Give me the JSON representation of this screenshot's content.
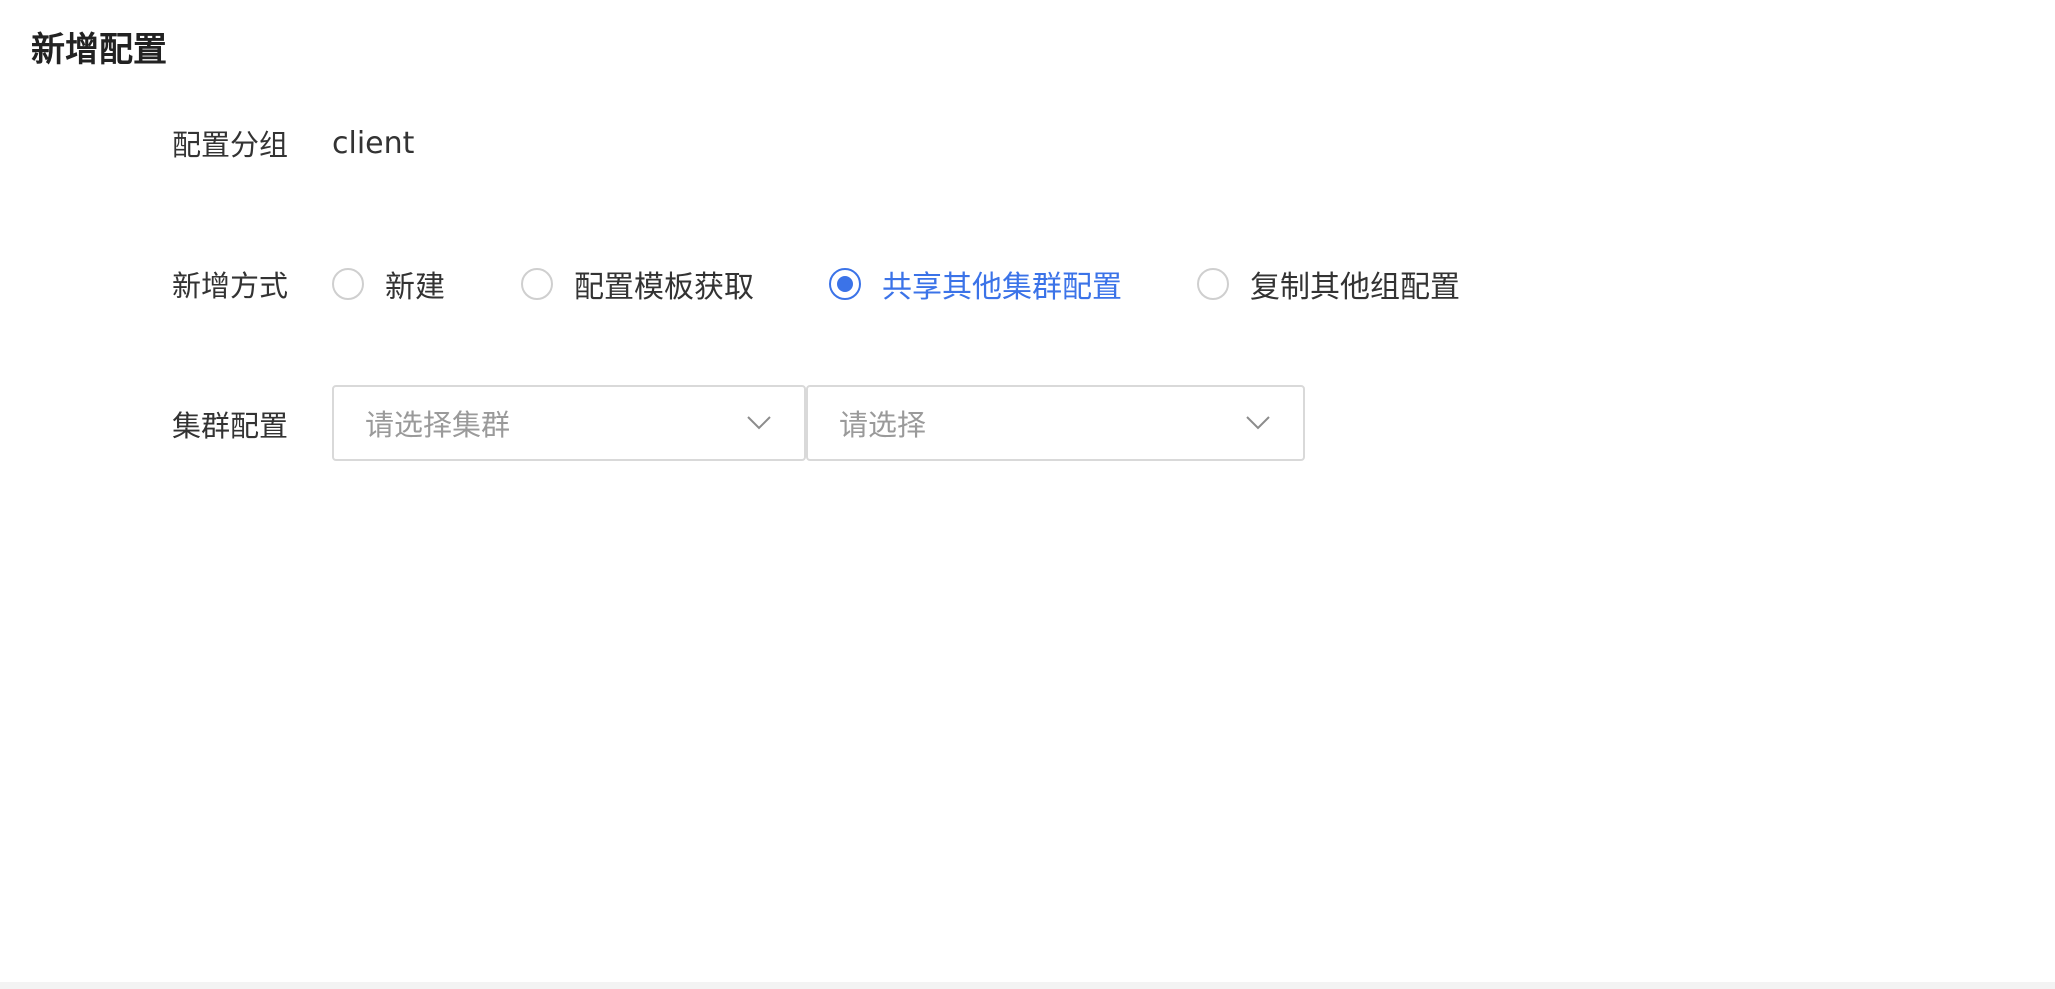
{
  "page": {
    "title": "新增配置"
  },
  "form": {
    "group": {
      "label": "配置分组",
      "value": "client"
    },
    "add_method": {
      "label": "新增方式",
      "options": [
        {
          "label": "新建",
          "checked": false
        },
        {
          "label": "配置模板获取",
          "checked": false
        },
        {
          "label": "共享其他集群配置",
          "checked": true
        },
        {
          "label": "复制其他组配置",
          "checked": false
        }
      ]
    },
    "cluster_config": {
      "label": "集群配置",
      "cluster_select": {
        "placeholder": "请选择集群"
      },
      "config_select": {
        "placeholder": "请选择"
      }
    }
  },
  "colors": {
    "accent": "#3b73e8",
    "border": "#d9d9d9",
    "placeholder": "#9a9a9a",
    "text": "#333333"
  },
  "icons": {
    "select_arrow": "chevron-down-icon"
  }
}
